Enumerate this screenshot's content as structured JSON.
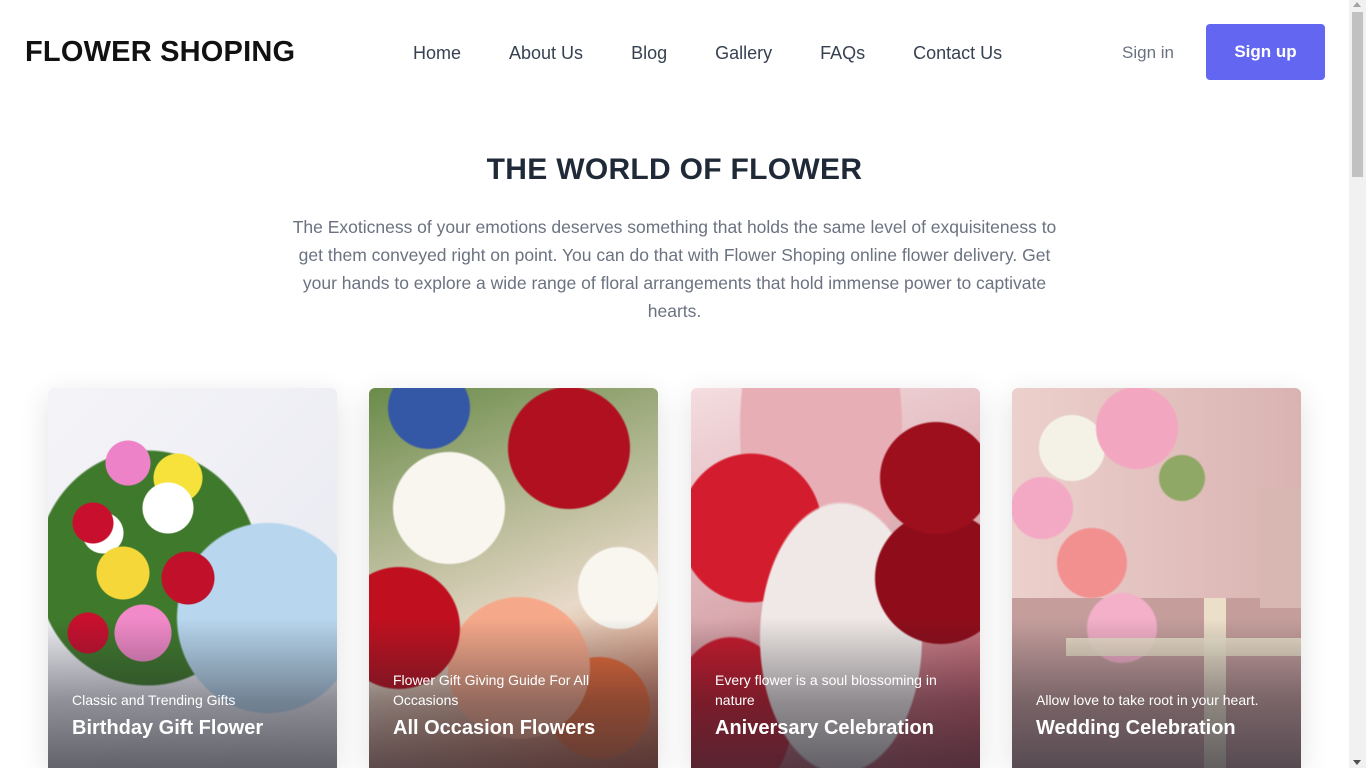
{
  "header": {
    "brand": "FLOWER SHOPING",
    "nav": [
      "Home",
      "About Us",
      "Blog",
      "Gallery",
      "FAQs",
      "Contact Us"
    ],
    "sign_in": "Sign in",
    "sign_up": "Sign up",
    "accent_color": "#6366f1"
  },
  "hero": {
    "title": "THE WORLD OF FLOWER",
    "description": "The Exoticness of your emotions deserves something that holds the same level of exquisiteness to get them conveyed right on point. You can do that with Flower Shoping online flower delivery. Get your hands to explore a wide range of floral arrangements that hold immense power to captivate hearts."
  },
  "cards": [
    {
      "subtitle": "Classic and Trending Gifts",
      "title": "Birthday Gift Flower",
      "image": "bouquet-of-roses-image"
    },
    {
      "subtitle": "Flower Gift Giving Guide For All Occasions",
      "title": "All Occasion Flowers",
      "image": "mixed-flowers-image"
    },
    {
      "subtitle": "Every flower is a soul blossoming in nature",
      "title": "Aniversary Celebration",
      "image": "red-roses-and-pearls-image"
    },
    {
      "subtitle": "Allow love to take root in your heart.",
      "title": "Wedding Celebration",
      "image": "flowers-and-gift-box-image"
    }
  ]
}
